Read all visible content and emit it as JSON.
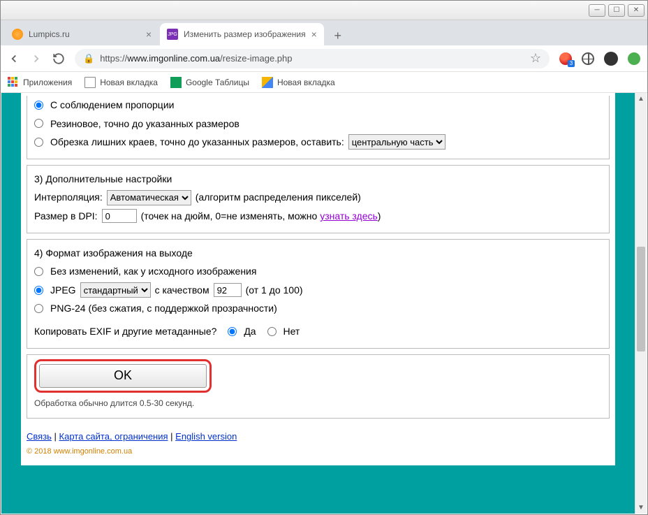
{
  "tabs": [
    {
      "title": "Lumpics.ru"
    },
    {
      "title": "Изменить размер изображения"
    }
  ],
  "url": {
    "prefix": "https://",
    "host": "www.imgonline.com.ua",
    "path": "/resize-image.php"
  },
  "bookmarks": {
    "apps": "Приложения",
    "b1": "Новая вкладка",
    "b2": "Google Таблицы",
    "b3": "Новая вкладка"
  },
  "sect2": {
    "opt1": "С соблюдением пропорции",
    "opt2": "Резиновое, точно до указанных размеров",
    "opt3": "Обрезка лишних краев, точно до указанных размеров, оставить:",
    "crop_select": "центральную часть"
  },
  "sect3": {
    "title": "3) Дополнительные настройки",
    "interp_label": "Интерполяция:",
    "interp_select": "Автоматическая",
    "interp_hint": "(алгоритм распределения пикселей)",
    "dpi_label": "Размер в DPI:",
    "dpi_value": "0",
    "dpi_hint1": "(точек на дюйм, 0=не изменять, можно ",
    "dpi_link": "узнать здесь",
    "dpi_hint2": ")"
  },
  "sect4": {
    "title": "4) Формат изображения на выходе",
    "opt1": "Без изменений, как у исходного изображения",
    "jpeg_label": "JPEG",
    "jpeg_select": "стандартный",
    "jpeg_q_label": "с качеством",
    "jpeg_q_value": "92",
    "jpeg_q_hint": "(от 1 до 100)",
    "opt3": "PNG-24 (без сжатия, с поддержкой прозрачности)",
    "exif_label": "Копировать EXIF и другие метаданные?",
    "yes": "Да",
    "no": "Нет"
  },
  "submit": {
    "ok": "OK",
    "note": "Обработка обычно длится 0.5-30 секунд."
  },
  "footer": {
    "l1": "Связь",
    "l2": "Карта сайта, ограничения",
    "l3": "English version",
    "copy": "© 2018 www.imgonline.com.ua"
  }
}
